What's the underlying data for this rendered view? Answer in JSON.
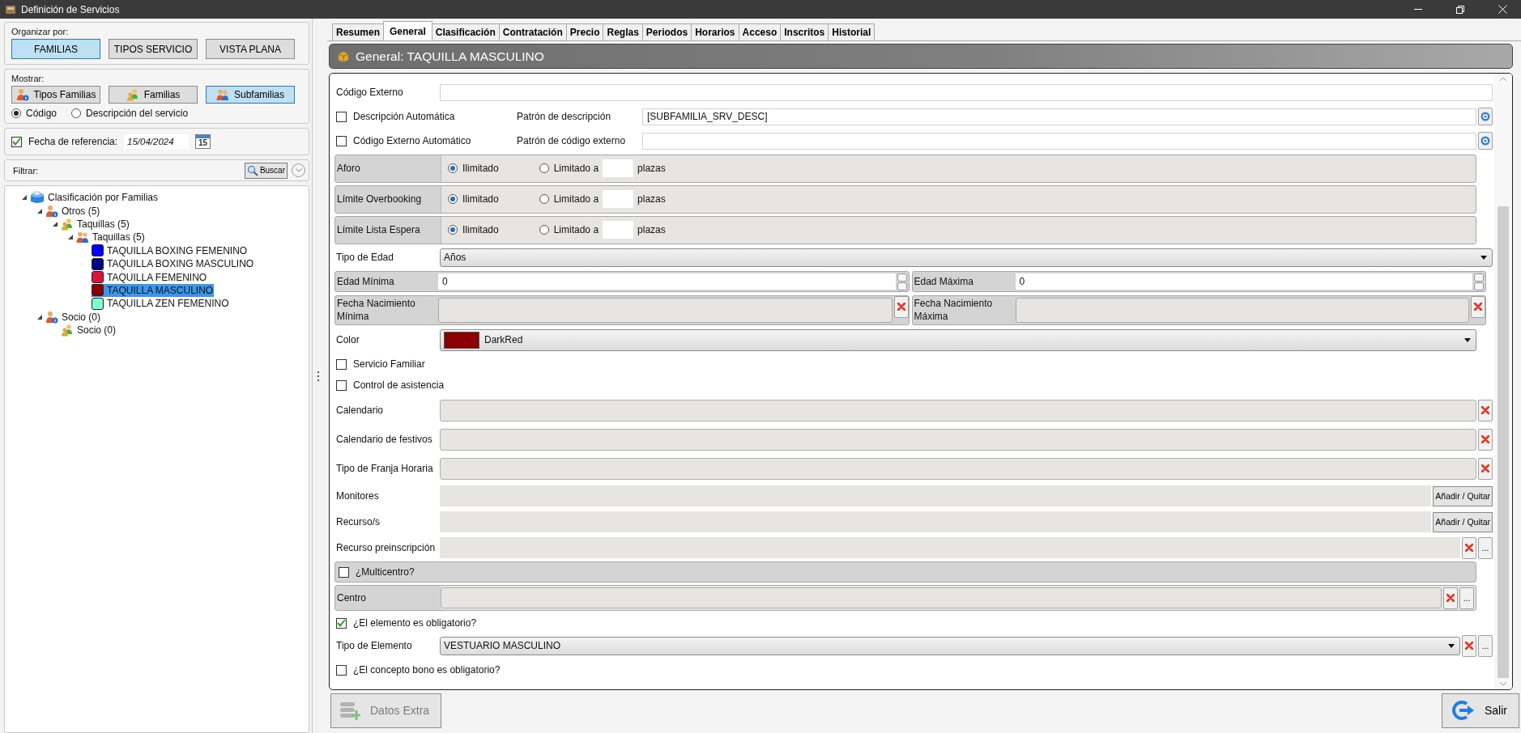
{
  "window": {
    "title": "Definición de Servicios"
  },
  "organize": {
    "label": "Organizar por:",
    "options": [
      {
        "label": "FAMILIAS",
        "selected": true
      },
      {
        "label": "TIPOS SERVICIO",
        "selected": false
      },
      {
        "label": "VISTA PLANA",
        "selected": false
      }
    ]
  },
  "show": {
    "label": "Mostrar:",
    "levels": [
      {
        "label": "Tipos Familias",
        "kind": "type",
        "selected": false
      },
      {
        "label": "Familias",
        "kind": "family",
        "selected": false
      },
      {
        "label": "Subfamilias",
        "kind": "subfamily",
        "selected": true
      }
    ],
    "display": [
      {
        "label": "Código",
        "selected": true
      },
      {
        "label": "Descripción del servicio",
        "selected": false
      }
    ]
  },
  "reference_date": {
    "label": "Fecha de referencia:",
    "checked": true,
    "value": "15/04/2024",
    "calendar_day": "15"
  },
  "filter": {
    "label": "Filtrar:",
    "search_button": "Buscar"
  },
  "tree": [
    {
      "label": "Clasificación por Familias",
      "kind": "root",
      "expanded": true,
      "selected": false,
      "children": [
        {
          "label": "Otros (5)",
          "kind": "type",
          "expanded": true,
          "selected": false,
          "children": [
            {
              "label": "Taquillas (5)",
              "kind": "family",
              "expanded": true,
              "selected": false,
              "children": [
                {
                  "label": "Taquillas (5)",
                  "kind": "subfamily",
                  "expanded": true,
                  "selected": false,
                  "children": [
                    {
                      "label": "TAQUILLA BOXING FEMENINO",
                      "kind": "service",
                      "color": "#0000ff",
                      "selected": false
                    },
                    {
                      "label": "TAQUILLA BOXING MASCULINO",
                      "kind": "service",
                      "color": "#00008b",
                      "selected": false
                    },
                    {
                      "label": "TAQUILLA FEMENINO",
                      "kind": "service",
                      "color": "#dc143c",
                      "selected": false
                    },
                    {
                      "label": "TAQUILLA MASCULINO",
                      "kind": "service",
                      "color": "#8b0000",
                      "selected": true
                    },
                    {
                      "label": "TAQUILLA ZEN FEMENINO",
                      "kind": "service",
                      "color": "#7fffd4",
                      "selected": false
                    }
                  ]
                }
              ]
            }
          ]
        },
        {
          "label": "Socio (0)",
          "kind": "type",
          "expanded": true,
          "selected": false,
          "children": [
            {
              "label": "Socio (0)",
              "kind": "family",
              "selected": false
            }
          ]
        }
      ]
    }
  ],
  "tabs": [
    {
      "label": "Resumen",
      "selected": false
    },
    {
      "label": "General",
      "selected": true
    },
    {
      "label": "Clasificación",
      "selected": false
    },
    {
      "label": "Contratación",
      "selected": false
    },
    {
      "label": "Precio",
      "selected": false
    },
    {
      "label": "Reglas",
      "selected": false
    },
    {
      "label": "Periodos",
      "selected": false
    },
    {
      "label": "Horarios",
      "selected": false
    },
    {
      "label": "Acceso",
      "selected": false
    },
    {
      "label": "Inscritos",
      "selected": false
    },
    {
      "label": "Historial",
      "selected": false
    }
  ],
  "header": {
    "title": "General: TAQUILLA MASCULINO"
  },
  "form": {
    "rows": [
      {
        "kind": "text",
        "label": "Código Externo"
      },
      {
        "kind": "pattern",
        "label": "Descripción Automática",
        "checked": false,
        "pattern_label": "Patrón de descripción",
        "value": "[SUBFAMILIA_SRV_DESC]",
        "buttons": [
          {
            "kind": "help"
          }
        ]
      },
      {
        "kind": "pattern",
        "label": "Código Externo Automático",
        "checked": false,
        "pattern_label": "Patrón de código externo",
        "buttons": [
          {
            "kind": "help"
          }
        ]
      },
      {
        "kind": "limit",
        "label": "Aforo",
        "options": [
          {
            "label": "Ilimitado",
            "selected": true
          },
          {
            "label": "Limitado a",
            "selected": false
          }
        ],
        "unit": "plazas"
      },
      {
        "kind": "limit",
        "label": "Límite Overbooking",
        "options": [
          {
            "label": "Ilimitado",
            "selected": true
          },
          {
            "label": "Limitado a",
            "selected": false
          }
        ],
        "unit": "plazas"
      },
      {
        "kind": "limit",
        "label": "Límite Lista Espera",
        "options": [
          {
            "label": "Ilimitado",
            "selected": true
          },
          {
            "label": "Limitado a",
            "selected": false
          }
        ],
        "unit": "plazas"
      },
      {
        "kind": "select",
        "label": "Tipo de Edad",
        "value": "Años"
      },
      {
        "kind": "number_pair",
        "items": [
          {
            "label": "Edad Mínima",
            "value": "0"
          },
          {
            "label": "Edad Máxima",
            "value": "0"
          }
        ]
      },
      {
        "kind": "date_pair",
        "items": [
          {
            "label": "Fecha Nacimiento Mínima",
            "buttons": [
              {
                "kind": "clear"
              }
            ]
          },
          {
            "label": "Fecha Nacimiento Máxima",
            "buttons": [
              {
                "kind": "clear"
              }
            ]
          }
        ]
      },
      {
        "kind": "color_select",
        "label": "Color",
        "value": "DarkRed",
        "color": "#8b0000"
      },
      {
        "kind": "checkbox",
        "label": "Servicio Familiar",
        "checked": false
      },
      {
        "kind": "checkbox",
        "label": "Control de asistencia",
        "checked": false
      },
      {
        "kind": "lookup",
        "label": "Calendario",
        "buttons": [
          {
            "kind": "clear"
          }
        ]
      },
      {
        "kind": "lookup",
        "label": "Calendario de festivos",
        "buttons": [
          {
            "kind": "clear"
          }
        ]
      },
      {
        "kind": "lookup",
        "label": "Tipo de Franja Horaria",
        "buttons": [
          {
            "kind": "clear"
          }
        ]
      },
      {
        "kind": "list",
        "label": "Monitores",
        "buttons": [
          {
            "kind": "text",
            "text": "Añadir / Quitar"
          }
        ]
      },
      {
        "kind": "list",
        "label": "Recurso/s",
        "buttons": [
          {
            "kind": "text",
            "text": "Añadir / Quitar"
          }
        ]
      },
      {
        "kind": "list",
        "label": "Recurso preinscripción",
        "buttons": [
          {
            "kind": "clear"
          },
          {
            "kind": "browse",
            "text": "..."
          }
        ]
      },
      {
        "kind": "group_checkbox",
        "label": "¿Multicentro?",
        "checked": false
      },
      {
        "kind": "group_lookup",
        "label": "Centro",
        "buttons": [
          {
            "kind": "clear"
          },
          {
            "kind": "browse",
            "text": "..."
          }
        ]
      },
      {
        "kind": "checkbox",
        "label": "¿El elemento es obligatorio?",
        "checked": true
      },
      {
        "kind": "select",
        "label": "Tipo de Elemento",
        "value": "VESTUARIO MASCULINO",
        "buttons": [
          {
            "kind": "clear"
          },
          {
            "kind": "browse",
            "text": "..."
          }
        ]
      },
      {
        "kind": "checkbox",
        "label": "¿El concepto bono es obligatorio?",
        "checked": false
      }
    ]
  },
  "footer": {
    "buttons": [
      {
        "label": "Datos Extra",
        "kind": "extra",
        "disabled": true
      },
      {
        "label": "Salir",
        "kind": "exit",
        "disabled": false
      }
    ]
  }
}
